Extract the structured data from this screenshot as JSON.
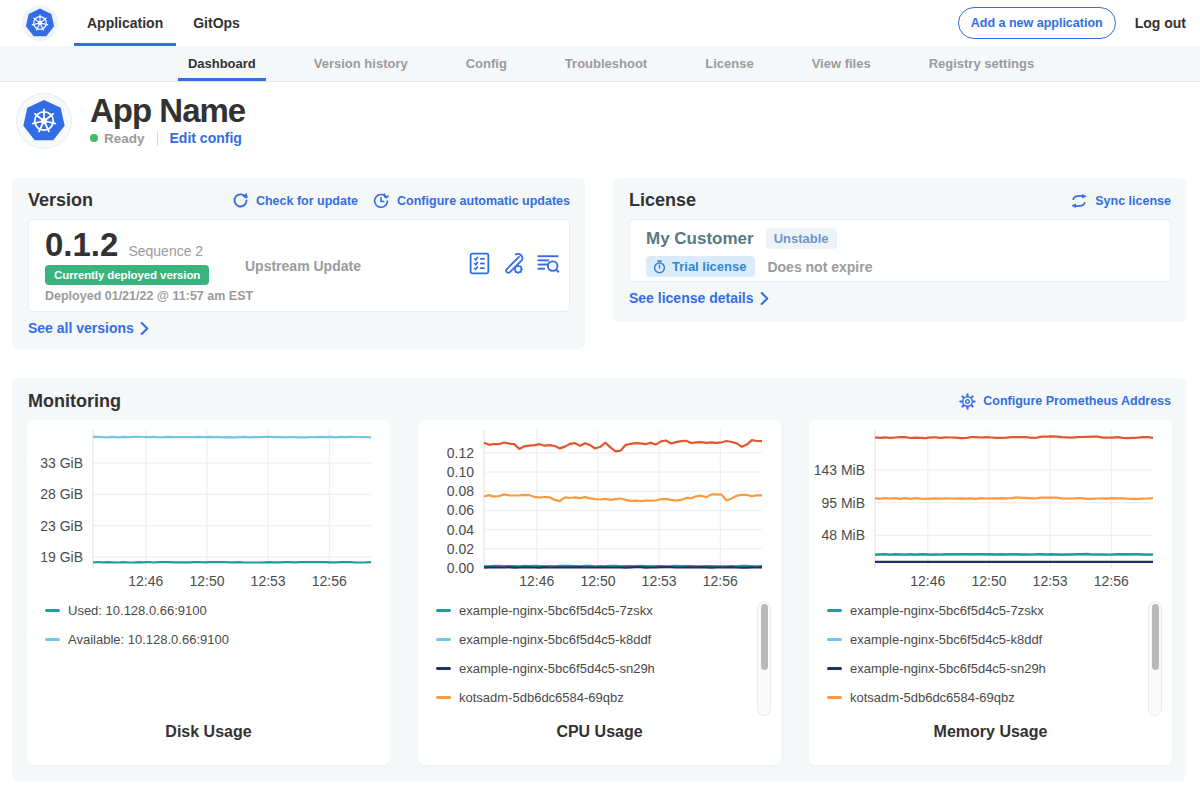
{
  "navbar": {
    "tabs": [
      {
        "label": "Application",
        "active": true
      },
      {
        "label": "GitOps",
        "active": false
      }
    ],
    "add_app_button": "Add a new application",
    "logout": "Log out"
  },
  "subnav": {
    "tabs": [
      {
        "label": "Dashboard",
        "active": true
      },
      {
        "label": "Version history",
        "active": false
      },
      {
        "label": "Config",
        "active": false
      },
      {
        "label": "Troubleshoot",
        "active": false
      },
      {
        "label": "License",
        "active": false
      },
      {
        "label": "View files",
        "active": false
      },
      {
        "label": "Registry settings",
        "active": false
      }
    ]
  },
  "app_header": {
    "name": "App Name",
    "status": "Ready",
    "edit_config": "Edit config"
  },
  "version_card": {
    "title": "Version",
    "check_for_update": "Check for update",
    "configure_auto": "Configure automatic updates",
    "version": "0.1.2",
    "sequence": "Sequence 2",
    "deployed_badge": "Currently deployed version",
    "deployed_at": "Deployed 01/21/22 @ 11:57 am EST",
    "upstream": "Upstream Update",
    "see_all": "See all versions"
  },
  "license_card": {
    "title": "License",
    "sync": "Sync license",
    "customer": "My Customer",
    "channel": "Unstable",
    "trial": "Trial license",
    "expiry": "Does not expire",
    "see_details": "See license details"
  },
  "monitoring": {
    "title": "Monitoring",
    "configure_prometheus": "Configure Prometheus Address"
  },
  "colors": {
    "accent_blue": "#326de6",
    "green_badge": "#3bb37d",
    "status_green": "#44bb66",
    "teal": "#209ba5",
    "light_blue": "#72c6e7",
    "navy": "#213064",
    "orange": "#f99b3e",
    "red": "#e2572e"
  },
  "chart_data": [
    {
      "type": "line",
      "title": "Disk Usage",
      "x_tick_labels": [
        "12:46",
        "12:50",
        "12:53",
        "12:56"
      ],
      "x_tick_fracs": [
        0.19,
        0.41,
        0.63,
        0.85
      ],
      "ylim": [
        17.0,
        37.5
      ],
      "yticks": [
        {
          "label": "33 GiB",
          "value": 32.6
        },
        {
          "label": "28 GiB",
          "value": 27.94
        },
        {
          "label": "23 GiB",
          "value": 23.28
        },
        {
          "label": "19 GiB",
          "value": 18.63
        }
      ],
      "grid": true,
      "legend_position": "bottom-left",
      "scrollbar": false,
      "series": [
        {
          "name": "Available: 10.128.0.66:9100",
          "color": "#72c6e7",
          "values": [
            36.48,
            36.47,
            36.43,
            36.41,
            36.49,
            36.42,
            36.47,
            36.45,
            36.47,
            36.47,
            36.46,
            36.45,
            36.47,
            36.42,
            36.43,
            36.47,
            36.43,
            36.46,
            36.45,
            36.45,
            36.44,
            36.47,
            36.44,
            36.47,
            36.43,
            36.43,
            36.42,
            36.43,
            36.42,
            36.45,
            36.47,
            36.42,
            36.43,
            36.45,
            36.47,
            36.49,
            36.45,
            36.43,
            36.42,
            36.43,
            36.43,
            36.42,
            36.41,
            36.45,
            36.43,
            36.49,
            36.45,
            36.47,
            36.42,
            36.48,
            36.45,
            36.48,
            36.46,
            36.45,
            36.45,
            36.42
          ]
        },
        {
          "name": "Used: 10.128.0.66:9100",
          "color": "#209ba5",
          "values": [
            17.81,
            17.89,
            17.85,
            17.88,
            17.84,
            17.82,
            17.86,
            17.81,
            17.82,
            17.86,
            17.83,
            17.89,
            17.82,
            17.87,
            17.86,
            17.87,
            17.83,
            17.85,
            17.85,
            17.85,
            17.88,
            17.89,
            17.83,
            17.86,
            17.86,
            17.87,
            17.89,
            17.83,
            17.83,
            17.86,
            17.82,
            17.82,
            17.82,
            17.81,
            17.85,
            17.86,
            17.83,
            17.83,
            17.87,
            17.87,
            17.85,
            17.86,
            17.88,
            17.87,
            17.86,
            17.86,
            17.88,
            17.84,
            17.85,
            17.86,
            17.88,
            17.88,
            17.82,
            17.82,
            17.83,
            17.87
          ]
        }
      ],
      "legend": [
        {
          "label": "Used: 10.128.0.66:9100",
          "color": "#209ba5"
        },
        {
          "label": "Available: 10.128.0.66:9100",
          "color": "#72c6e7"
        }
      ]
    },
    {
      "type": "line",
      "title": "CPU Usage",
      "x_tick_labels": [
        "12:46",
        "12:50",
        "12:53",
        "12:56"
      ],
      "x_tick_fracs": [
        0.19,
        0.41,
        0.63,
        0.85
      ],
      "ylim": [
        0,
        0.1438
      ],
      "yticks": [
        {
          "label": "0.12",
          "value": 0.12
        },
        {
          "label": "0.10",
          "value": 0.1
        },
        {
          "label": "0.08",
          "value": 0.08
        },
        {
          "label": "0.06",
          "value": 0.06
        },
        {
          "label": "0.04",
          "value": 0.04
        },
        {
          "label": "0.02",
          "value": 0.02
        },
        {
          "label": "0.00",
          "value": 0.0
        }
      ],
      "grid": true,
      "legend_position": "bottom-left",
      "scrollbar": true,
      "series": [
        {
          "name": "example-nginx-5bc6f5d4c5-k8ddf",
          "color": "#72c6e7",
          "values": [
            0.0011,
            0.0011,
            0.0014,
            0.0012,
            0.0012,
            0.0013,
            0.0013,
            0.0011,
            0.001,
            0.0012,
            0.0012,
            0.0012,
            0.0013,
            0.0013,
            0.0014,
            0.001,
            0.0012,
            0.0011,
            0.0013,
            0.0011,
            0.0011,
            0.0012,
            0.0012,
            0.0011,
            0.0011,
            0.0014,
            0.0012,
            0.0013,
            0.0012,
            0.001,
            0.0014,
            0.0013,
            0.0014,
            0.0014,
            0.0013,
            0.0011,
            0.0012,
            0.0011,
            0.0012,
            0.001,
            0.0012,
            0.0014,
            0.0011,
            0.0013,
            0.0012,
            0.0012,
            0.0014,
            0.0014,
            0.0012,
            0.0013,
            0.0011,
            0.0011,
            0.0014,
            0.0012,
            0.0012,
            0.0013
          ]
        },
        {
          "name": "example-nginx-5bc6f5d4c5-7zskx",
          "color": "#209ba5",
          "values": [
            0.002,
            0.0018,
            0.0022,
            0.0022,
            0.0019,
            0.0021,
            0.0021,
            0.0018,
            0.0022,
            0.002,
            0.0022,
            0.002,
            0.0017,
            0.0019,
            0.0017,
            0.0023,
            0.0022,
            0.0022,
            0.0019,
            0.0017,
            0.0022,
            0.0023,
            0.0018,
            0.002,
            0.0017,
            0.0022,
            0.0022,
            0.0018,
            0.002,
            0.002,
            0.0019,
            0.0022,
            0.002,
            0.0018,
            0.002,
            0.0021,
            0.0018,
            0.0019,
            0.0023,
            0.0021,
            0.002,
            0.002,
            0.0018,
            0.0018,
            0.0019,
            0.0021,
            0.0018,
            0.0018,
            0.0017,
            0.0021,
            0.0018,
            0.0022,
            0.0022,
            0.0017,
            0.0018,
            0.0021
          ]
        },
        {
          "name": "example-nginx-5bc6f5d4c5-sn29h",
          "color": "#213064",
          "values": [
            0.0004,
            0.0006,
            0.0006,
            0.0007,
            0.0005,
            0.0008,
            0.0004,
            0.0005,
            0.0006,
            0.0007,
            0.0005,
            0.0004,
            0.0008,
            0.0005,
            0.0006,
            0.0006,
            0.0006,
            0.0006,
            0.0006,
            0.0008,
            0.0005,
            0.0007,
            0.0005,
            0.0006,
            0.0007,
            0.0005,
            0.0005,
            0.0007,
            0.0004,
            0.0006,
            0.0008,
            0.0008,
            0.0004,
            0.0005,
            0.0005,
            0.0008,
            0.0008,
            0.0008,
            0.0005,
            0.0005,
            0.0007,
            0.0007,
            0.0006,
            0.0008,
            0.0007,
            0.0004,
            0.0007,
            0.0005,
            0.0007,
            0.0008,
            0.0005,
            0.0004,
            0.0004,
            0.0006,
            0.0005,
            0.0006
          ]
        },
        {
          "name": "kotsadm-5db6dc6584-69qbz",
          "color": "#f99b3e",
          "values": [
            0.0745,
            0.076,
            0.0744,
            0.075,
            0.0767,
            0.0757,
            0.0755,
            0.0758,
            0.0763,
            0.0759,
            0.0742,
            0.0735,
            0.074,
            0.0737,
            0.071,
            0.0697,
            0.0737,
            0.0729,
            0.0736,
            0.0727,
            0.0739,
            0.0725,
            0.0717,
            0.0714,
            0.0721,
            0.0711,
            0.0717,
            0.0724,
            0.0711,
            0.0699,
            0.0701,
            0.0697,
            0.0702,
            0.0701,
            0.0703,
            0.0717,
            0.0721,
            0.0711,
            0.0702,
            0.071,
            0.073,
            0.0727,
            0.0747,
            0.0753,
            0.0739,
            0.0767,
            0.0768,
            0.0764,
            0.0704,
            0.0725,
            0.0753,
            0.0762,
            0.0762,
            0.0748,
            0.0757,
            0.0757
          ]
        },
        {
          "name": "",
          "color": "#e2572e",
          "values": [
            0.1305,
            0.1284,
            0.1292,
            0.1291,
            0.1308,
            0.1296,
            0.1291,
            0.124,
            0.1268,
            0.1274,
            0.128,
            0.129,
            0.1274,
            0.128,
            0.1271,
            0.1246,
            0.1265,
            0.1293,
            0.1301,
            0.1273,
            0.13,
            0.1281,
            0.1245,
            0.1263,
            0.1306,
            0.1257,
            0.1215,
            0.1222,
            0.1281,
            0.1294,
            0.13,
            0.1298,
            0.1291,
            0.1306,
            0.1286,
            0.132,
            0.1329,
            0.1297,
            0.1312,
            0.1321,
            0.1325,
            0.1303,
            0.1309,
            0.1311,
            0.1304,
            0.1309,
            0.1304,
            0.131,
            0.1323,
            0.1313,
            0.1298,
            0.1263,
            0.1286,
            0.1333,
            0.1323,
            0.1322
          ]
        }
      ],
      "legend": [
        {
          "label": "example-nginx-5bc6f5d4c5-7zskx",
          "color": "#209ba5"
        },
        {
          "label": "example-nginx-5bc6f5d4c5-k8ddf",
          "color": "#72c6e7"
        },
        {
          "label": "example-nginx-5bc6f5d4c5-sn29h",
          "color": "#213064"
        },
        {
          "label": "kotsadm-5db6dc6584-69qbz",
          "color": "#f99b3e"
        }
      ]
    },
    {
      "type": "line",
      "title": "Memory Usage",
      "x_tick_labels": [
        "12:46",
        "12:50",
        "12:53",
        "12:56"
      ],
      "x_tick_fracs": [
        0.19,
        0.41,
        0.63,
        0.85
      ],
      "ylim": [
        0,
        201.5
      ],
      "yticks": [
        {
          "label": "143 MiB",
          "value": 143.05
        },
        {
          "label": "95 MiB",
          "value": 95.37
        },
        {
          "label": "48 MiB",
          "value": 47.68
        }
      ],
      "grid": true,
      "legend_position": "bottom-left",
      "scrollbar": true,
      "series": [
        {
          "name": "example-nginx-5bc6f5d4c5-k8ddf",
          "color": "#72c6e7",
          "values": [
            19.5,
            19.5,
            19.6,
            19.3,
            19.4,
            19.3,
            19.4,
            19.1,
            19.1,
            19.3,
            19.0,
            19.2,
            19.4,
            19.2,
            19.1,
            19.3,
            19.1,
            19.4,
            19.0,
            19.2,
            19.3,
            19.0,
            19.4,
            19.1,
            19.3,
            19.0,
            19.2,
            19.1,
            19.2,
            19.5,
            19.2,
            19.5,
            19.5,
            19.2,
            19.0,
            19.0,
            19.3,
            19.6,
            19.2,
            19.4,
            19.5,
            19.4,
            19.5,
            19.6,
            19.1,
            19.0,
            19.1,
            19.1,
            19.4,
            19.3,
            19.1,
            19.4,
            19.5,
            19.1,
            19.4,
            19.4
          ]
        },
        {
          "name": "example-nginx-5bc6f5d4c5-7zskx",
          "color": "#209ba5",
          "values": [
            19.6,
            19.9,
            20.1,
            19.7,
            20.2,
            20.0,
            19.7,
            20.2,
            19.5,
            20.3,
            20.3,
            19.6,
            19.9,
            19.7,
            20.5,
            20.2,
            20.3,
            20.5,
            20.4,
            20.1,
            20.5,
            20.4,
            20.1,
            20.2,
            20.0,
            20.3,
            20.0,
            20.4,
            20.2,
            20.0,
            19.8,
            19.7,
            20.1,
            20.3,
            20.0,
            20.1,
            19.8,
            19.6,
            19.8,
            19.8,
            20.1,
            20.2,
            20.7,
            19.7,
            20.0,
            19.9,
            19.7,
            19.9,
            20.4,
            20.1,
            20.2,
            20.4,
            20.3,
            19.9,
            19.5,
            19.9
          ]
        },
        {
          "name": "example-nginx-5bc6f5d4c5-sn29h",
          "color": "#213064",
          "values": [
            8.9,
            9.1,
            9.1,
            8.9,
            8.9,
            8.9,
            9.1,
            9.1,
            9.0,
            9.1,
            8.9,
            9.1,
            9.0,
            8.9,
            9.1,
            9.1,
            9.0,
            8.9,
            9.1,
            9.1,
            9.0,
            9.0,
            9.0,
            9.0,
            9.0,
            9.1,
            9.1,
            8.9,
            9.1,
            9.0,
            9.1,
            9.1,
            9.0,
            9.1,
            9.1,
            8.9,
            9.1,
            9.0,
            9.0,
            9.0,
            9.1,
            8.9,
            9.1,
            9.1,
            8.9,
            9.1,
            8.9,
            9.0,
            9.0,
            9.0,
            8.9,
            9.1,
            8.9,
            8.9,
            9.1,
            9.0
          ]
        },
        {
          "name": "kotsadm-5db6dc6584-69qbz",
          "color": "#f99b3e",
          "values": [
            101.7,
            101.4,
            102.1,
            101.5,
            102.0,
            101.0,
            102.1,
            101.1,
            102.1,
            101.2,
            101.0,
            101.4,
            101.8,
            101.3,
            101.6,
            101.5,
            101.4,
            101.6,
            101.2,
            101.8,
            100.9,
            102.0,
            101.5,
            101.8,
            101.8,
            101.9,
            101.6,
            102.1,
            103.3,
            102.4,
            102.3,
            101.8,
            101.9,
            102.6,
            102.6,
            102.7,
            102.6,
            101.7,
            101.2,
            101.5,
            102.0,
            101.9,
            101.1,
            101.0,
            101.5,
            101.7,
            101.3,
            101.9,
            101.8,
            101.7,
            101.2,
            101.1,
            100.9,
            101.2,
            101.5,
            101.9
          ]
        },
        {
          "name": "",
          "color": "#e2572e",
          "values": [
            190.8,
            190.0,
            190.7,
            190.1,
            190.5,
            191.1,
            191.1,
            189.8,
            190.4,
            190.1,
            189.7,
            190.9,
            190.7,
            190.1,
            190.9,
            190.6,
            190.4,
            189.7,
            189.8,
            191.1,
            191.1,
            190.6,
            191.0,
            190.6,
            189.9,
            189.9,
            190.2,
            191.1,
            191.0,
            191.1,
            191.1,
            190.1,
            190.4,
            191.9,
            191.7,
            192.2,
            191.9,
            191.2,
            190.9,
            190.2,
            191.2,
            191.3,
            191.6,
            191.7,
            191.8,
            190.3,
            190.4,
            190.2,
            191.0,
            190.1,
            189.7,
            190.0,
            190.2,
            191.1,
            191.2,
            190.1
          ]
        }
      ],
      "legend": [
        {
          "label": "example-nginx-5bc6f5d4c5-7zskx",
          "color": "#209ba5"
        },
        {
          "label": "example-nginx-5bc6f5d4c5-k8ddf",
          "color": "#72c6e7"
        },
        {
          "label": "example-nginx-5bc6f5d4c5-sn29h",
          "color": "#213064"
        },
        {
          "label": "kotsadm-5db6dc6584-69qbz",
          "color": "#f99b3e"
        }
      ]
    }
  ]
}
